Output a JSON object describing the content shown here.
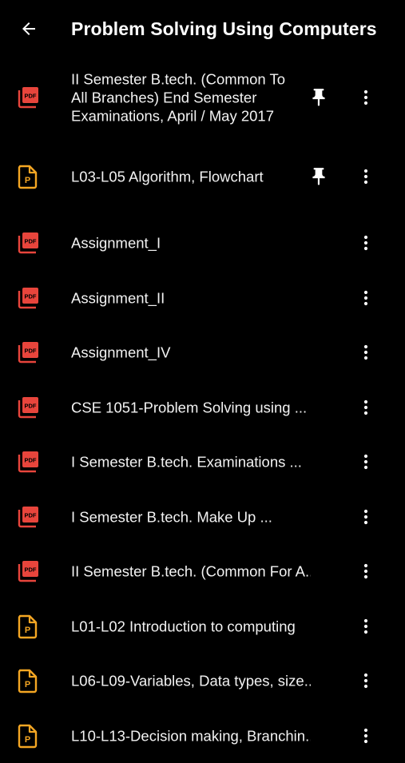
{
  "appbar": {
    "back_icon": "arrow-left-icon",
    "title": "Problem Solving Using Computers"
  },
  "colors": {
    "background": "#000000",
    "pdf_icon": "#e8453c",
    "ppt_icon": "#f4a623",
    "text": "#ffffff"
  },
  "files": [
    {
      "type": "pdf",
      "name": "II Semester B.tech. (Common To All Branches) End Semester Examinations, April / May 2017",
      "pinned": true
    },
    {
      "type": "ppt",
      "name": "L03-L05 Algorithm, Flowchart",
      "pinned": true
    },
    {
      "type": "pdf",
      "name": "Assignment_I",
      "pinned": false
    },
    {
      "type": "pdf",
      "name": "Assignment_II",
      "pinned": false
    },
    {
      "type": "pdf",
      "name": "Assignment_IV",
      "pinned": false
    },
    {
      "type": "pdf",
      "name": "CSE 1051-Problem Solving using ...",
      "pinned": false
    },
    {
      "type": "pdf",
      "name": "I Semester B.tech. Examinations ...",
      "pinned": false
    },
    {
      "type": "pdf",
      "name": "I Semester B.tech. Make Up ...",
      "pinned": false
    },
    {
      "type": "pdf",
      "name": "II Semester B.tech. (Common For A...",
      "pinned": false
    },
    {
      "type": "ppt",
      "name": "L01-L02 Introduction to computing",
      "pinned": false
    },
    {
      "type": "ppt",
      "name": "L06-L09-Variables, Data types, size...",
      "pinned": false
    },
    {
      "type": "ppt",
      "name": "L10-L13-Decision making, Branchin...",
      "pinned": false
    }
  ],
  "icons": {
    "pdf": "pdf-file-icon",
    "ppt": "presentation-file-icon",
    "pin": "pin-icon",
    "more": "more-vertical-icon"
  }
}
